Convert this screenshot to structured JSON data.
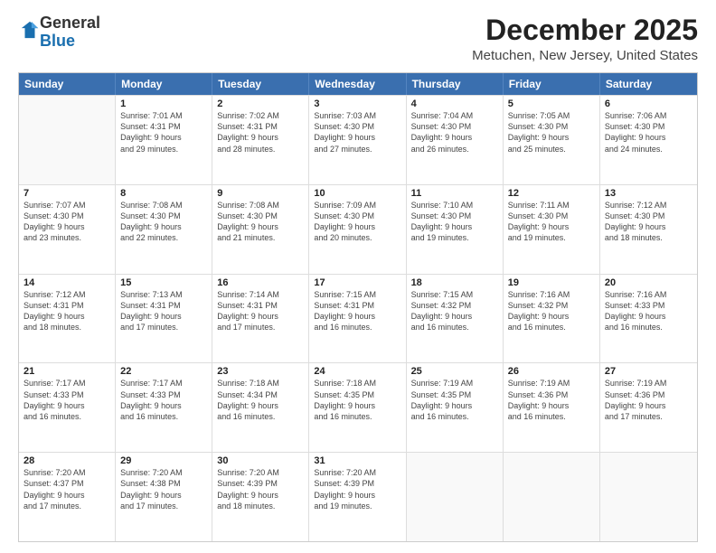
{
  "logo": {
    "general": "General",
    "blue": "Blue"
  },
  "title": "December 2025",
  "location": "Metuchen, New Jersey, United States",
  "header_days": [
    "Sunday",
    "Monday",
    "Tuesday",
    "Wednesday",
    "Thursday",
    "Friday",
    "Saturday"
  ],
  "weeks": [
    [
      {
        "day": "",
        "info": ""
      },
      {
        "day": "1",
        "info": "Sunrise: 7:01 AM\nSunset: 4:31 PM\nDaylight: 9 hours\nand 29 minutes."
      },
      {
        "day": "2",
        "info": "Sunrise: 7:02 AM\nSunset: 4:31 PM\nDaylight: 9 hours\nand 28 minutes."
      },
      {
        "day": "3",
        "info": "Sunrise: 7:03 AM\nSunset: 4:30 PM\nDaylight: 9 hours\nand 27 minutes."
      },
      {
        "day": "4",
        "info": "Sunrise: 7:04 AM\nSunset: 4:30 PM\nDaylight: 9 hours\nand 26 minutes."
      },
      {
        "day": "5",
        "info": "Sunrise: 7:05 AM\nSunset: 4:30 PM\nDaylight: 9 hours\nand 25 minutes."
      },
      {
        "day": "6",
        "info": "Sunrise: 7:06 AM\nSunset: 4:30 PM\nDaylight: 9 hours\nand 24 minutes."
      }
    ],
    [
      {
        "day": "7",
        "info": "Sunrise: 7:07 AM\nSunset: 4:30 PM\nDaylight: 9 hours\nand 23 minutes."
      },
      {
        "day": "8",
        "info": "Sunrise: 7:08 AM\nSunset: 4:30 PM\nDaylight: 9 hours\nand 22 minutes."
      },
      {
        "day": "9",
        "info": "Sunrise: 7:08 AM\nSunset: 4:30 PM\nDaylight: 9 hours\nand 21 minutes."
      },
      {
        "day": "10",
        "info": "Sunrise: 7:09 AM\nSunset: 4:30 PM\nDaylight: 9 hours\nand 20 minutes."
      },
      {
        "day": "11",
        "info": "Sunrise: 7:10 AM\nSunset: 4:30 PM\nDaylight: 9 hours\nand 19 minutes."
      },
      {
        "day": "12",
        "info": "Sunrise: 7:11 AM\nSunset: 4:30 PM\nDaylight: 9 hours\nand 19 minutes."
      },
      {
        "day": "13",
        "info": "Sunrise: 7:12 AM\nSunset: 4:30 PM\nDaylight: 9 hours\nand 18 minutes."
      }
    ],
    [
      {
        "day": "14",
        "info": "Sunrise: 7:12 AM\nSunset: 4:31 PM\nDaylight: 9 hours\nand 18 minutes."
      },
      {
        "day": "15",
        "info": "Sunrise: 7:13 AM\nSunset: 4:31 PM\nDaylight: 9 hours\nand 17 minutes."
      },
      {
        "day": "16",
        "info": "Sunrise: 7:14 AM\nSunset: 4:31 PM\nDaylight: 9 hours\nand 17 minutes."
      },
      {
        "day": "17",
        "info": "Sunrise: 7:15 AM\nSunset: 4:31 PM\nDaylight: 9 hours\nand 16 minutes."
      },
      {
        "day": "18",
        "info": "Sunrise: 7:15 AM\nSunset: 4:32 PM\nDaylight: 9 hours\nand 16 minutes."
      },
      {
        "day": "19",
        "info": "Sunrise: 7:16 AM\nSunset: 4:32 PM\nDaylight: 9 hours\nand 16 minutes."
      },
      {
        "day": "20",
        "info": "Sunrise: 7:16 AM\nSunset: 4:33 PM\nDaylight: 9 hours\nand 16 minutes."
      }
    ],
    [
      {
        "day": "21",
        "info": "Sunrise: 7:17 AM\nSunset: 4:33 PM\nDaylight: 9 hours\nand 16 minutes."
      },
      {
        "day": "22",
        "info": "Sunrise: 7:17 AM\nSunset: 4:33 PM\nDaylight: 9 hours\nand 16 minutes."
      },
      {
        "day": "23",
        "info": "Sunrise: 7:18 AM\nSunset: 4:34 PM\nDaylight: 9 hours\nand 16 minutes."
      },
      {
        "day": "24",
        "info": "Sunrise: 7:18 AM\nSunset: 4:35 PM\nDaylight: 9 hours\nand 16 minutes."
      },
      {
        "day": "25",
        "info": "Sunrise: 7:19 AM\nSunset: 4:35 PM\nDaylight: 9 hours\nand 16 minutes."
      },
      {
        "day": "26",
        "info": "Sunrise: 7:19 AM\nSunset: 4:36 PM\nDaylight: 9 hours\nand 16 minutes."
      },
      {
        "day": "27",
        "info": "Sunrise: 7:19 AM\nSunset: 4:36 PM\nDaylight: 9 hours\nand 17 minutes."
      }
    ],
    [
      {
        "day": "28",
        "info": "Sunrise: 7:20 AM\nSunset: 4:37 PM\nDaylight: 9 hours\nand 17 minutes."
      },
      {
        "day": "29",
        "info": "Sunrise: 7:20 AM\nSunset: 4:38 PM\nDaylight: 9 hours\nand 17 minutes."
      },
      {
        "day": "30",
        "info": "Sunrise: 7:20 AM\nSunset: 4:39 PM\nDaylight: 9 hours\nand 18 minutes."
      },
      {
        "day": "31",
        "info": "Sunrise: 7:20 AM\nSunset: 4:39 PM\nDaylight: 9 hours\nand 19 minutes."
      },
      {
        "day": "",
        "info": ""
      },
      {
        "day": "",
        "info": ""
      },
      {
        "day": "",
        "info": ""
      }
    ]
  ]
}
